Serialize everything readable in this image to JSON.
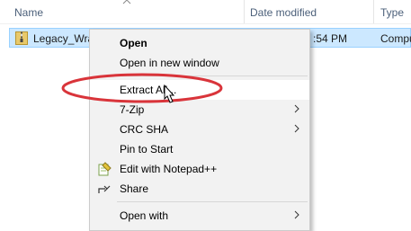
{
  "columns": {
    "name": "Name",
    "date_modified": "Date modified",
    "type": "Type"
  },
  "file": {
    "name": "Legacy_Wra",
    "date_fragment": ":54 PM",
    "type_fragment": "Compu"
  },
  "context_menu": {
    "items": [
      {
        "label": "Open",
        "bold": true,
        "submenu": false
      },
      {
        "label": "Open in new window",
        "bold": false,
        "submenu": false
      },
      {
        "label": "Extract All...",
        "bold": false,
        "submenu": false,
        "highlighted": true
      },
      {
        "label": "7-Zip",
        "bold": false,
        "submenu": true
      },
      {
        "label": "CRC SHA",
        "bold": false,
        "submenu": true
      },
      {
        "label": "Pin to Start",
        "bold": false,
        "submenu": false
      },
      {
        "label": "Edit with Notepad++",
        "bold": false,
        "submenu": false,
        "icon": "notepad-plus-plus-icon"
      },
      {
        "label": "Share",
        "bold": false,
        "submenu": false,
        "icon": "share-icon"
      },
      {
        "label": "Open with",
        "bold": false,
        "submenu": true
      }
    ]
  },
  "colors": {
    "selection_fill": "#cce8ff",
    "selection_border": "#99d1ff",
    "menu_background": "#f2f2f2",
    "annotation_red": "#d9343a"
  }
}
